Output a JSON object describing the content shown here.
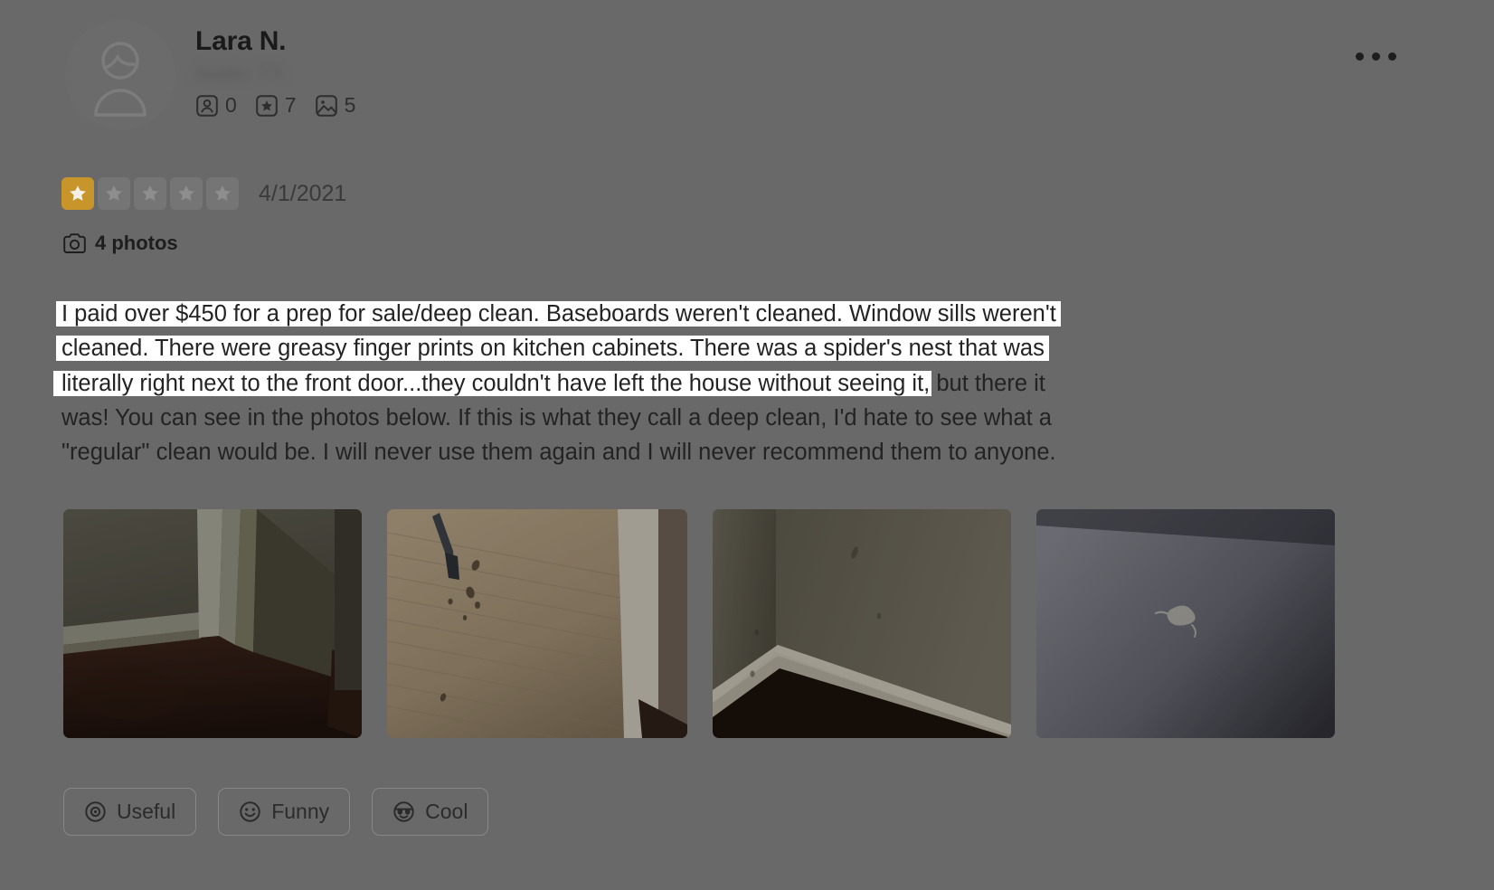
{
  "background_color": "#696969",
  "highlight_color": "#ffffff",
  "star_filled_color": "#c8952a",
  "star_empty_color": "#757575",
  "user": {
    "name": "Lara N.",
    "location": "Austin, TX",
    "stats": [
      {
        "icon": "friends-icon",
        "label": "friends",
        "count": "0"
      },
      {
        "icon": "reviews-star-icon",
        "label": "reviews",
        "count": "7"
      },
      {
        "icon": "photos-icon",
        "label": "photos",
        "count": "5"
      }
    ]
  },
  "rating": {
    "value": 1,
    "max": 5,
    "date": "4/1/2021"
  },
  "photo_count_label": "4 photos",
  "review": {
    "lines": [
      {
        "text": "I paid over $450 for a prep for sale/deep clean. Baseboards weren't cleaned. Window sills weren't",
        "highlighted": true
      },
      {
        "text": "cleaned. There were greasy finger prints on kitchen cabinets. There was a spider's nest that was",
        "highlighted": true
      },
      {
        "highlighted_part": "literally right next to the front door...they couldn't have left the house without seeing it,",
        "plain_part": " but there it",
        "highlighted": "partial"
      },
      {
        "text": "was! You can see in the photos below. If this is what they call a deep clean, I'd hate to see what a",
        "highlighted": false
      },
      {
        "text": "\"regular\" clean would be. I will never use them again and I will never recommend them to anyone.",
        "highlighted": false
      }
    ],
    "full_text": "I paid over $450 for a prep for sale/deep clean. Baseboards weren't cleaned. Window sills weren't cleaned. There were greasy finger prints on kitchen cabinets. There was a spider's nest that was literally right next to the front door...they couldn't have left the house without seeing it, but there it was! You can see in the photos below. If this is what they call a deep clean, I'd hate to see what a \"regular\" clean would be. I will never use them again and I will never recommend them to anyone."
  },
  "photos": [
    {
      "name": "photo-1",
      "alt": "Door frame and baseboard above dark tile floor"
    },
    {
      "name": "photo-2",
      "alt": "Wood paneling with debris and a metal bracket"
    },
    {
      "name": "photo-3",
      "alt": "Wall corner with white baseboard and dark floor"
    },
    {
      "name": "photo-4",
      "alt": "Dark gray wall with a spider's nest"
    }
  ],
  "feedback_buttons": [
    {
      "icon": "useful-icon",
      "label": "Useful"
    },
    {
      "icon": "funny-icon",
      "label": "Funny"
    },
    {
      "icon": "cool-icon",
      "label": "Cool"
    }
  ],
  "overflow_menu": {
    "label": "More options"
  }
}
